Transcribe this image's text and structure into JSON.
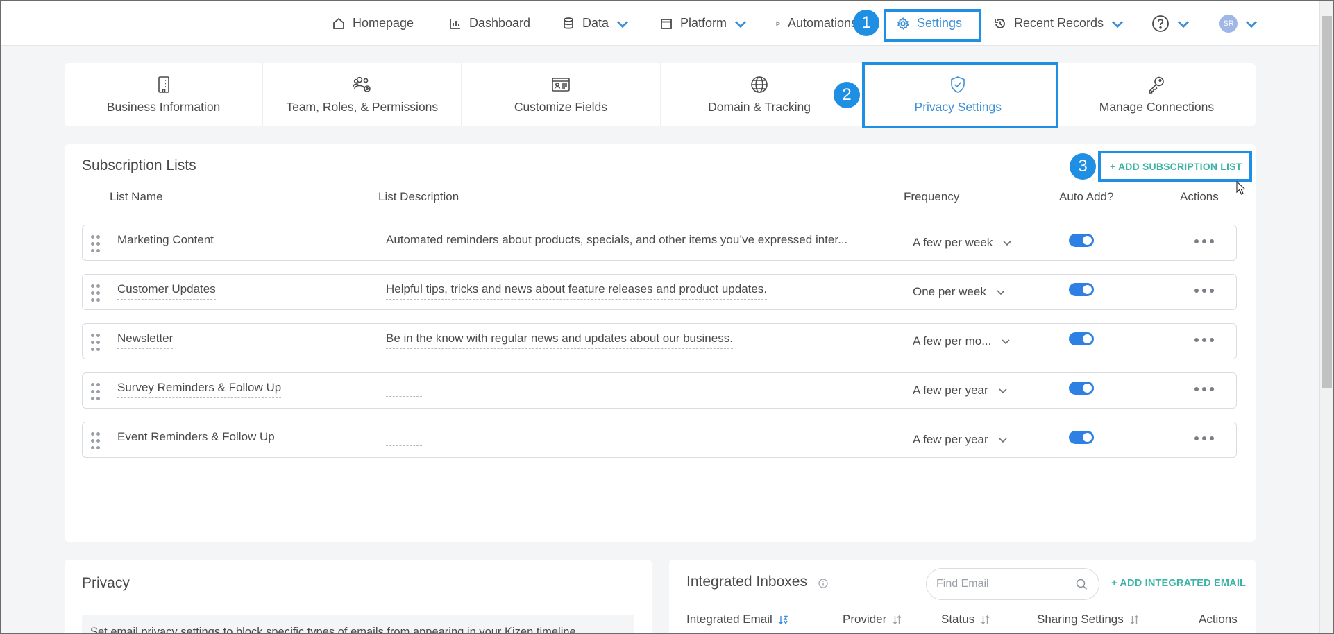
{
  "nav": {
    "homepage": "Homepage",
    "dashboard": "Dashboard",
    "data": "Data",
    "platform": "Platform",
    "automations": "Automations",
    "settings": "Settings",
    "recent_records": "Recent Records",
    "avatar_initials": "SR"
  },
  "tabs": [
    {
      "label": "Business Information",
      "icon": "building-icon"
    },
    {
      "label": "Team, Roles, & Permissions",
      "icon": "team-gear-icon"
    },
    {
      "label": "Customize Fields",
      "icon": "id-card-icon"
    },
    {
      "label": "Domain & Tracking",
      "icon": "globe-icon"
    },
    {
      "label": "Privacy Settings",
      "icon": "shield-check-icon",
      "active": true
    },
    {
      "label": "Manage Connections",
      "icon": "key-icon"
    }
  ],
  "annotations": {
    "step1": "1",
    "step2": "2",
    "step3": "3"
  },
  "subscriptions": {
    "title": "Subscription Lists",
    "add_label": "+ ADD SUBSCRIPTION LIST",
    "columns": {
      "name": "List Name",
      "description": "List Description",
      "frequency": "Frequency",
      "auto_add": "Auto Add?",
      "actions": "Actions"
    },
    "rows": [
      {
        "name": "Marketing Content",
        "description": "Automated reminders about products, specials, and other items you’ve expressed inter...",
        "frequency": "A few per week",
        "auto_add": true
      },
      {
        "name": "Customer Updates",
        "description": "Helpful tips, tricks and news about feature releases and product updates.",
        "frequency": "One per week",
        "auto_add": true
      },
      {
        "name": "Newsletter",
        "description": "Be in the know with regular news and updates about our business.",
        "frequency": "A few per mo...",
        "auto_add": true
      },
      {
        "name": "Survey Reminders & Follow Up",
        "description": "",
        "frequency": "A few per year",
        "auto_add": true
      },
      {
        "name": "Event Reminders & Follow Up",
        "description": "",
        "frequency": "A few per year",
        "auto_add": true
      }
    ]
  },
  "privacy": {
    "title": "Privacy",
    "description": "Set email privacy settings to block specific types of emails from appearing in your Kizen timeline."
  },
  "inboxes": {
    "title": "Integrated Inboxes",
    "search_placeholder": "Find Email",
    "add_label": "+ ADD INTEGRATED EMAIL",
    "columns": {
      "email": "Integrated Email",
      "provider": "Provider",
      "status": "Status",
      "sharing": "Sharing Settings",
      "actions": "Actions"
    }
  },
  "colors": {
    "accent": "#3d8fd6",
    "teal_link": "#3bb3a5",
    "highlight": "#1e8fe3",
    "toggle_on": "#2f80e4"
  }
}
